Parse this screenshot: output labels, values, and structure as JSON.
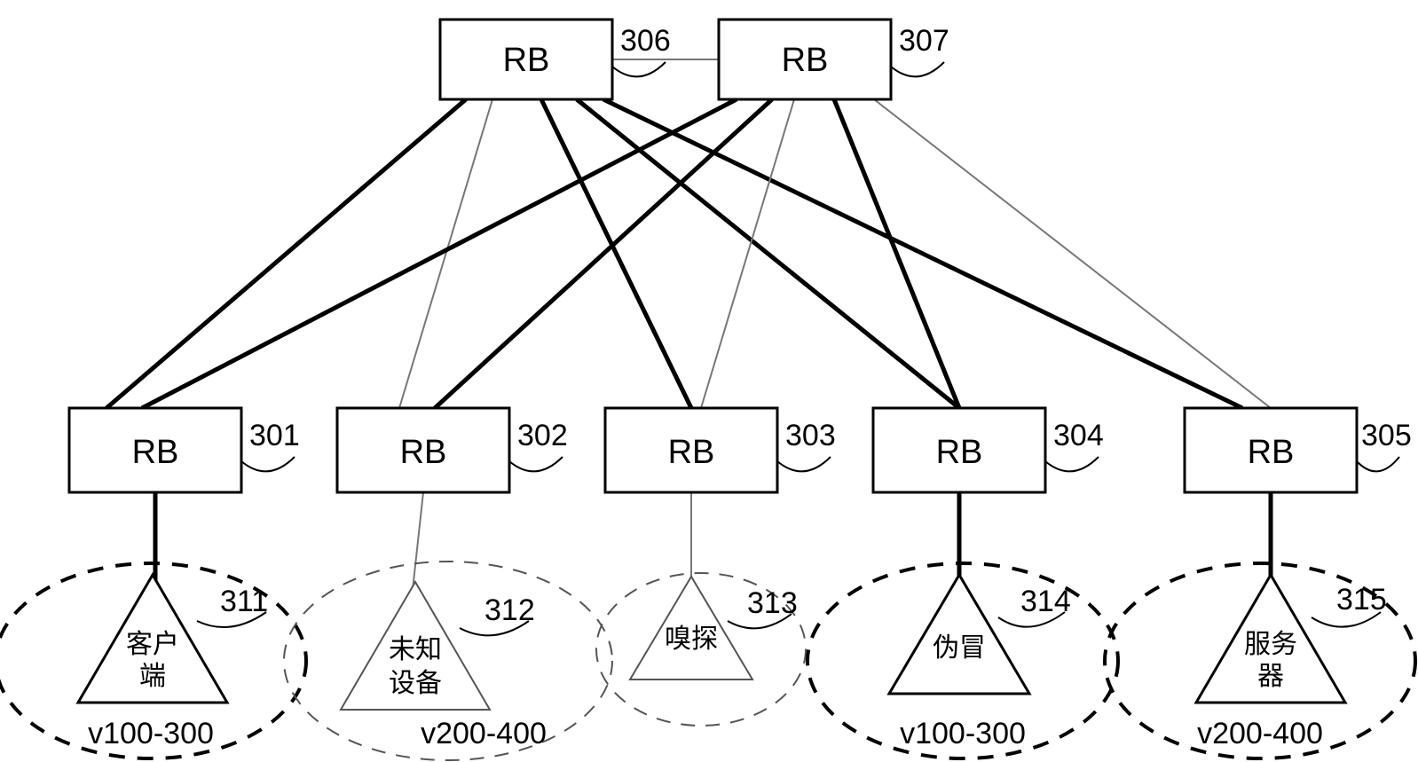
{
  "rb_label": "RB",
  "top_nodes": {
    "n306": {
      "ref": "306"
    },
    "n307": {
      "ref": "307"
    }
  },
  "bottom_nodes": {
    "n301": {
      "ref": "301"
    },
    "n302": {
      "ref": "302"
    },
    "n303": {
      "ref": "303"
    },
    "n304": {
      "ref": "304"
    },
    "n305": {
      "ref": "305"
    }
  },
  "devices": {
    "d311": {
      "ref": "311",
      "line1": "客户",
      "line2": "端",
      "range": "v100-300"
    },
    "d312": {
      "ref": "312",
      "line1": "未知",
      "line2": "设备",
      "range": "v200-400"
    },
    "d313": {
      "ref": "313",
      "line1": "嗅探",
      "line2": ""
    },
    "d314": {
      "ref": "314",
      "line1": "伪冒",
      "line2": "",
      "range": "v100-300"
    },
    "d315": {
      "ref": "315",
      "line1": "服务",
      "line2": "器",
      "range": "v200-400"
    }
  },
  "chart_data": {
    "type": "network-diagram",
    "nodes": [
      {
        "id": "306",
        "type": "RB",
        "tier": "top"
      },
      {
        "id": "307",
        "type": "RB",
        "tier": "top"
      },
      {
        "id": "301",
        "type": "RB",
        "tier": "edge"
      },
      {
        "id": "302",
        "type": "RB",
        "tier": "edge"
      },
      {
        "id": "303",
        "type": "RB",
        "tier": "edge"
      },
      {
        "id": "304",
        "type": "RB",
        "tier": "edge"
      },
      {
        "id": "305",
        "type": "RB",
        "tier": "edge"
      },
      {
        "id": "311",
        "type": "device",
        "label": "客户端",
        "attached_rb": "301",
        "vlan_range": "v100-300"
      },
      {
        "id": "312",
        "type": "device",
        "label": "未知设备",
        "attached_rb": "302",
        "vlan_range": "v200-400"
      },
      {
        "id": "313",
        "type": "device",
        "label": "嗅探",
        "attached_rb": "303"
      },
      {
        "id": "314",
        "type": "device",
        "label": "伪冒",
        "attached_rb": "304",
        "vlan_range": "v100-300"
      },
      {
        "id": "315",
        "type": "device",
        "label": "服务器",
        "attached_rb": "305",
        "vlan_range": "v200-400"
      }
    ],
    "edges": [
      {
        "from": "306",
        "to": "307",
        "style": "thin"
      },
      {
        "from": "306",
        "to": "301",
        "style": "thick"
      },
      {
        "from": "306",
        "to": "302",
        "style": "thin"
      },
      {
        "from": "306",
        "to": "303",
        "style": "thick"
      },
      {
        "from": "306",
        "to": "304",
        "style": "thick"
      },
      {
        "from": "306",
        "to": "305",
        "style": "thick"
      },
      {
        "from": "307",
        "to": "301",
        "style": "thick"
      },
      {
        "from": "307",
        "to": "302",
        "style": "thick"
      },
      {
        "from": "307",
        "to": "303",
        "style": "thin"
      },
      {
        "from": "307",
        "to": "304",
        "style": "thick"
      },
      {
        "from": "307",
        "to": "305",
        "style": "thin"
      },
      {
        "from": "301",
        "to": "311",
        "style": "thick"
      },
      {
        "from": "302",
        "to": "312",
        "style": "thin"
      },
      {
        "from": "303",
        "to": "313",
        "style": "thin"
      },
      {
        "from": "304",
        "to": "314",
        "style": "thick"
      },
      {
        "from": "305",
        "to": "315",
        "style": "thick"
      }
    ]
  }
}
